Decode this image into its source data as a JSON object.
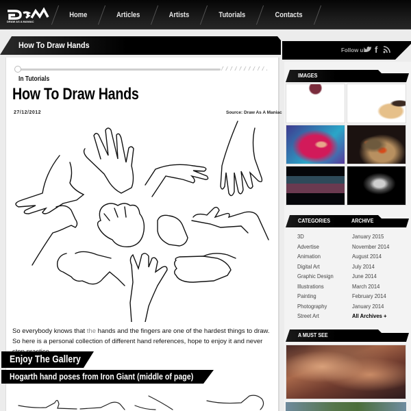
{
  "site": {
    "logo_text": "DaM",
    "logo_tagline": "DRAW AS A MANIAC"
  },
  "nav": {
    "items": [
      {
        "label": "Home"
      },
      {
        "label": "Articles"
      },
      {
        "label": "Artists"
      },
      {
        "label": "Tutorials"
      },
      {
        "label": "Contacts"
      }
    ]
  },
  "title_band": {
    "title": "How To Draw Hands"
  },
  "follow": {
    "label": "Follow us",
    "icons": [
      "twitter-icon",
      "facebook-icon",
      "rss-icon"
    ],
    "twitter_glyph": "🐦",
    "facebook_glyph": "f",
    "rss_glyph": "◝"
  },
  "post": {
    "category": "In Tutorials",
    "title": "How To Draw Hands",
    "date": "27/12/2012",
    "source": "Source: Draw As A Maniac",
    "body_before": "So everybody knows that ",
    "body_muted": "the",
    "body_after": " hands and the fingers are one of the hardest things to draw. So here is a personal collection of different hand references, hope to enjoy it and never stop practice.",
    "gallery_heading": "Enjoy The Gallery",
    "subheading": "Hogarth hand poses from Iron Giant (middle of page)"
  },
  "sidebar": {
    "images_heading": "IMAGES",
    "images": [
      {
        "name": "abstract-figure-white",
        "colors": [
          "#ffffff",
          "#f4f0f0",
          "#7a2c3c"
        ]
      },
      {
        "name": "character-illustration",
        "colors": [
          "#ffffff",
          "#e6c08a",
          "#3b2a22"
        ]
      },
      {
        "name": "red-hair-woman",
        "colors": [
          "#3f3a8f",
          "#d21a5a",
          "#2aa6c8"
        ]
      },
      {
        "name": "dark-creature",
        "colors": [
          "#1b1210",
          "#6e5a3e",
          "#d64a1a"
        ]
      },
      {
        "name": "night-city-building",
        "colors": [
          "#05060a",
          "#2e4a5a",
          "#c03050"
        ]
      },
      {
        "name": "monochrome-portrait",
        "colors": [
          "#000000",
          "#cfcfcf",
          "#555555"
        ]
      }
    ],
    "categories_heading": "CATEGORIES",
    "archive_heading": "ARCHIVE",
    "categories": [
      "3D",
      "Advertise",
      "Animation",
      "Digital Art",
      "Graphic Design",
      "Illustrations",
      "Painting",
      "Photography",
      "Street Art"
    ],
    "archive": [
      "January 2015",
      "November 2014",
      "August 2014",
      "July 2014",
      "June 2014",
      "March 2014",
      "February 2014",
      "January 2014"
    ],
    "all_archives": "All Archives +",
    "must_see_heading": "A MUST SEE"
  }
}
